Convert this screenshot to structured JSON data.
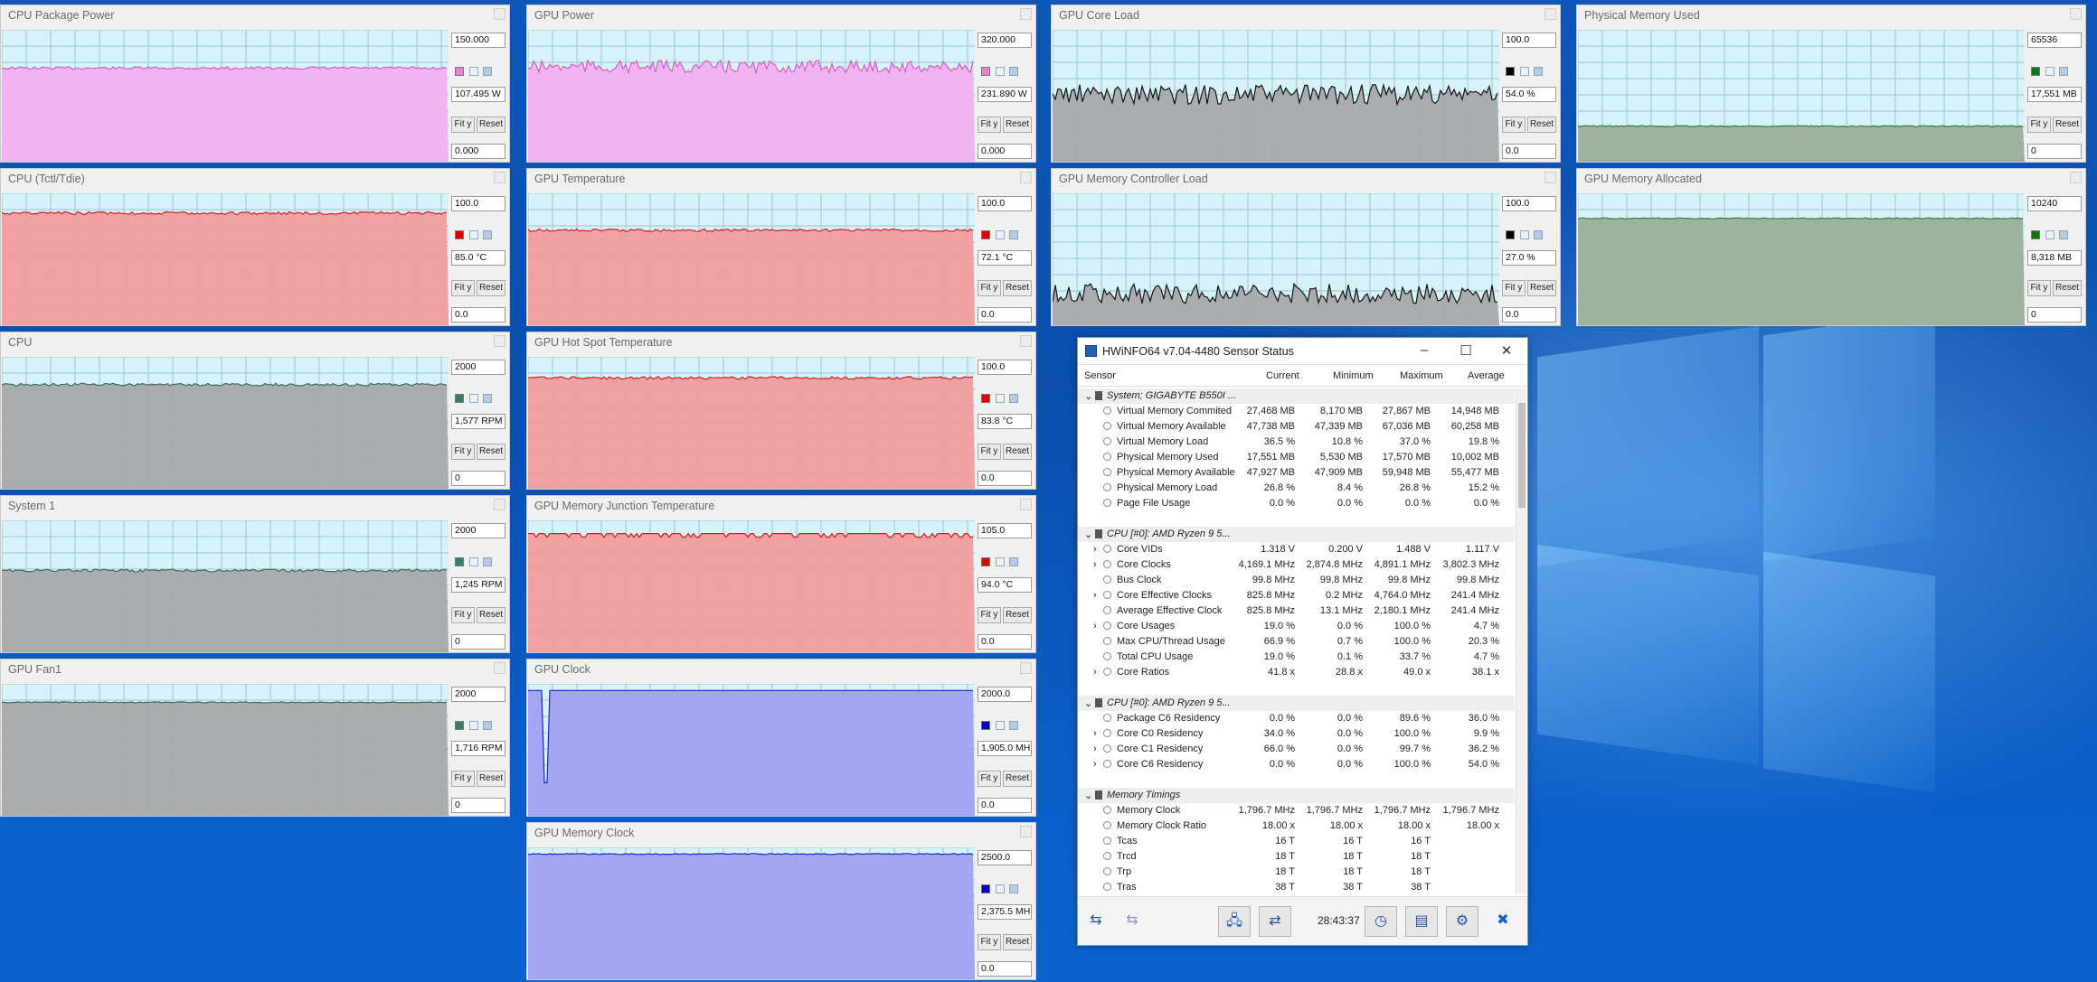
{
  "graphs": [
    {
      "title": "CPU Package Power",
      "max": "150.000",
      "current": "107.495 W",
      "min": "0.000",
      "color": "#f4aef0",
      "line": "#d15fc9",
      "swatch": "#e880d4",
      "level": 0.71,
      "style": "smooth",
      "fit": "Fit y",
      "reset": "Reset"
    },
    {
      "title": "GPU Power",
      "max": "320.000",
      "current": "231.890 W",
      "min": "0.000",
      "color": "#f4aef0",
      "line": "#d15fc9",
      "swatch": "#e880d4",
      "level": 0.72,
      "style": "jagged",
      "fit": "Fit y",
      "reset": "Reset"
    },
    {
      "title": "GPU Core Load",
      "max": "100.0",
      "current": "54.0 %",
      "min": "0.0",
      "color": "#a7a7a7",
      "line": "#151515",
      "swatch": "#000000",
      "level": 0.54,
      "style": "spiky",
      "fit": "Fit y",
      "reset": "Reset"
    },
    {
      "title": "Physical Memory Used",
      "max": "65536",
      "current": "17,551 MB",
      "min": "0",
      "color": "#9aae96",
      "line": "#3c7c3c",
      "swatch": "#0a7a0a",
      "level": 0.27,
      "style": "flat",
      "fit": "Fit y",
      "reset": "Reset"
    },
    {
      "title": "CPU (Tctl/Tdie)",
      "max": "100.0",
      "current": "85.0 °C",
      "min": "0.0",
      "color": "#f49b9b",
      "line": "#d11f1f",
      "swatch": "#e00000",
      "level": 0.85,
      "style": "smooth",
      "fit": "Fit y",
      "reset": "Reset"
    },
    {
      "title": "GPU Temperature",
      "max": "100.0",
      "current": "72.1 °C",
      "min": "0.0",
      "color": "#f49b9b",
      "line": "#d11f1f",
      "swatch": "#e00000",
      "level": 0.72,
      "style": "smooth",
      "fit": "Fit y",
      "reset": "Reset"
    },
    {
      "title": "GPU Memory Controller Load",
      "max": "100.0",
      "current": "27.0 %",
      "min": "0.0",
      "color": "#a7a7a7",
      "line": "#151515",
      "swatch": "#000000",
      "level": 0.27,
      "style": "spiky",
      "fit": "Fit y",
      "reset": "Reset"
    },
    {
      "title": "GPU Memory Allocated",
      "max": "10240",
      "current": "8,318 MB",
      "min": "0",
      "color": "#9aae96",
      "line": "#3c7c3c",
      "swatch": "#0a7a0a",
      "level": 0.81,
      "style": "flat",
      "fit": "Fit y",
      "reset": "Reset"
    },
    {
      "title": "CPU",
      "max": "2000",
      "current": "1,577 RPM",
      "min": "0",
      "color": "#a7a7a7",
      "line": "#3d6a60",
      "swatch": "#3d7a6a",
      "level": 0.79,
      "style": "smooth",
      "fit": "Fit y",
      "reset": "Reset"
    },
    {
      "title": "GPU Hot Spot Temperature",
      "max": "100.0",
      "current": "83.8 °C",
      "min": "0.0",
      "color": "#f49b9b",
      "line": "#d11f1f",
      "swatch": "#e00000",
      "level": 0.84,
      "style": "smooth",
      "fit": "Fit y",
      "reset": "Reset"
    },
    {
      "title": "System 1",
      "max": "2000",
      "current": "1,245 RPM",
      "min": "0",
      "color": "#a7a7a7",
      "line": "#3d6a60",
      "swatch": "#3d7a6a",
      "level": 0.62,
      "style": "smooth",
      "fit": "Fit y",
      "reset": "Reset"
    },
    {
      "title": "GPU Memory Junction Temperature",
      "max": "105.0",
      "current": "94.0 °C",
      "min": "0.0",
      "color": "#f49b9b",
      "line": "#d11f1f",
      "swatch": "#e00000",
      "level": 0.9,
      "style": "steps",
      "fit": "Fit y",
      "reset": "Reset"
    },
    {
      "title": "GPU Fan1",
      "max": "2000",
      "current": "1,716 RPM",
      "min": "0",
      "color": "#a7a7a7",
      "line": "#3d6a60",
      "swatch": "#3d7a6a",
      "level": 0.86,
      "style": "flat",
      "fit": "Fit y",
      "reset": "Reset"
    },
    {
      "title": "GPU Clock",
      "max": "2000.0",
      "current": "1,905.0 MH",
      "min": "0.0",
      "color": "#a0a0f4",
      "line": "#2222c8",
      "swatch": "#0000d0",
      "level": 0.95,
      "style": "dip",
      "fit": "Fit y",
      "reset": "Reset"
    },
    {
      "title": "GPU Memory Clock",
      "max": "2500.0",
      "current": "2,375.5 MH",
      "min": "0.0",
      "color": "#a0a0f4",
      "line": "#2222c8",
      "swatch": "#0000d0",
      "level": 0.95,
      "style": "flat",
      "fit": "Fit y",
      "reset": "Reset"
    }
  ],
  "hwinfo": {
    "title": "HWiNFO64 v7.04-4480 Sensor Status",
    "headers": {
      "sensor": "Sensor",
      "current": "Current",
      "minimum": "Minimum",
      "maximum": "Maximum",
      "average": "Average"
    },
    "rows": [
      {
        "type": "group",
        "name": "System: GIGABYTE B550I ..."
      },
      {
        "type": "item",
        "name": "Virtual Memory Commited",
        "cur": "27,468 MB",
        "min": "8,170 MB",
        "max": "27,867 MB",
        "avg": "14,948 MB"
      },
      {
        "type": "item",
        "name": "Virtual Memory Available",
        "cur": "47,738 MB",
        "min": "47,339 MB",
        "max": "67,036 MB",
        "avg": "60,258 MB"
      },
      {
        "type": "item",
        "name": "Virtual Memory Load",
        "cur": "36.5 %",
        "min": "10.8 %",
        "max": "37.0 %",
        "avg": "19.8 %"
      },
      {
        "type": "item",
        "name": "Physical Memory Used",
        "cur": "17,551 MB",
        "min": "5,530 MB",
        "max": "17,570 MB",
        "avg": "10,002 MB"
      },
      {
        "type": "item",
        "name": "Physical Memory Available",
        "cur": "47,927 MB",
        "min": "47,909 MB",
        "max": "59,948 MB",
        "avg": "55,477 MB"
      },
      {
        "type": "item",
        "name": "Physical Memory Load",
        "cur": "26.8 %",
        "min": "8.4 %",
        "max": "26.8 %",
        "avg": "15.2 %"
      },
      {
        "type": "item",
        "name": "Page File Usage",
        "cur": "0.0 %",
        "min": "0.0 %",
        "max": "0.0 %",
        "avg": "0.0 %"
      },
      {
        "type": "blank",
        "name": ""
      },
      {
        "type": "group",
        "name": "CPU [#0]: AMD Ryzen 9 5..."
      },
      {
        "type": "item",
        "name": "Core VIDs",
        "cur": "1.318 V",
        "min": "0.200 V",
        "max": "1.488 V",
        "avg": "1.117 V",
        "exp": true
      },
      {
        "type": "item",
        "name": "Core Clocks",
        "cur": "4,169.1 MHz",
        "min": "2,874.8 MHz",
        "max": "4,891.1 MHz",
        "avg": "3,802.3 MHz",
        "exp": true
      },
      {
        "type": "item",
        "name": "Bus Clock",
        "cur": "99.8 MHz",
        "min": "99.8 MHz",
        "max": "99.8 MHz",
        "avg": "99.8 MHz"
      },
      {
        "type": "item",
        "name": "Core Effective Clocks",
        "cur": "825.8 MHz",
        "min": "0.2 MHz",
        "max": "4,764.0 MHz",
        "avg": "241.4 MHz",
        "exp": true
      },
      {
        "type": "item",
        "name": "Average Effective Clock",
        "cur": "825.8 MHz",
        "min": "13.1 MHz",
        "max": "2,180.1 MHz",
        "avg": "241.4 MHz"
      },
      {
        "type": "item",
        "name": "Core Usages",
        "cur": "19.0 %",
        "min": "0.0 %",
        "max": "100.0 %",
        "avg": "4.7 %",
        "exp": true
      },
      {
        "type": "item",
        "name": "Max CPU/Thread Usage",
        "cur": "66.9 %",
        "min": "0.7 %",
        "max": "100.0 %",
        "avg": "20.3 %"
      },
      {
        "type": "item",
        "name": "Total CPU Usage",
        "cur": "19.0 %",
        "min": "0.1 %",
        "max": "33.7 %",
        "avg": "4.7 %"
      },
      {
        "type": "item",
        "name": "Core Ratios",
        "cur": "41.8 x",
        "min": "28.8 x",
        "max": "49.0 x",
        "avg": "38.1 x",
        "exp": true
      },
      {
        "type": "blank",
        "name": ""
      },
      {
        "type": "group",
        "name": "CPU [#0]: AMD Ryzen 9 5..."
      },
      {
        "type": "item",
        "name": "Package C6 Residency",
        "cur": "0.0 %",
        "min": "0.0 %",
        "max": "89.6 %",
        "avg": "36.0 %"
      },
      {
        "type": "item",
        "name": "Core C0 Residency",
        "cur": "34.0 %",
        "min": "0.0 %",
        "max": "100.0 %",
        "avg": "9.9 %",
        "exp": true
      },
      {
        "type": "item",
        "name": "Core C1 Residency",
        "cur": "66.0 %",
        "min": "0.0 %",
        "max": "99.7 %",
        "avg": "36.2 %",
        "exp": true
      },
      {
        "type": "item",
        "name": "Core C6 Residency",
        "cur": "0.0 %",
        "min": "0.0 %",
        "max": "100.0 %",
        "avg": "54.0 %",
        "exp": true
      },
      {
        "type": "blank",
        "name": ""
      },
      {
        "type": "group",
        "name": "Memory Timings"
      },
      {
        "type": "item",
        "name": "Memory Clock",
        "cur": "1,796.7 MHz",
        "min": "1,796.7 MHz",
        "max": "1,796.7 MHz",
        "avg": "1,796.7 MHz"
      },
      {
        "type": "item",
        "name": "Memory Clock Ratio",
        "cur": "18.00 x",
        "min": "18.00 x",
        "max": "18.00 x",
        "avg": "18.00 x"
      },
      {
        "type": "item",
        "name": "Tcas",
        "cur": "16 T",
        "min": "16 T",
        "max": "16 T",
        "avg": ""
      },
      {
        "type": "item",
        "name": "Trcd",
        "cur": "18 T",
        "min": "18 T",
        "max": "18 T",
        "avg": ""
      },
      {
        "type": "item",
        "name": "Trp",
        "cur": "18 T",
        "min": "18 T",
        "max": "18 T",
        "avg": ""
      },
      {
        "type": "item",
        "name": "Tras",
        "cur": "38 T",
        "min": "38 T",
        "max": "38 T",
        "avg": ""
      }
    ],
    "clock": "28:43:37",
    "buttons": {
      "nav_left": "⇆",
      "nav_right": "⇆",
      "network": "🖧",
      "connect": "⇄",
      "timer": "◷",
      "export": "▤",
      "settings": "⚙",
      "close": "✖"
    }
  }
}
